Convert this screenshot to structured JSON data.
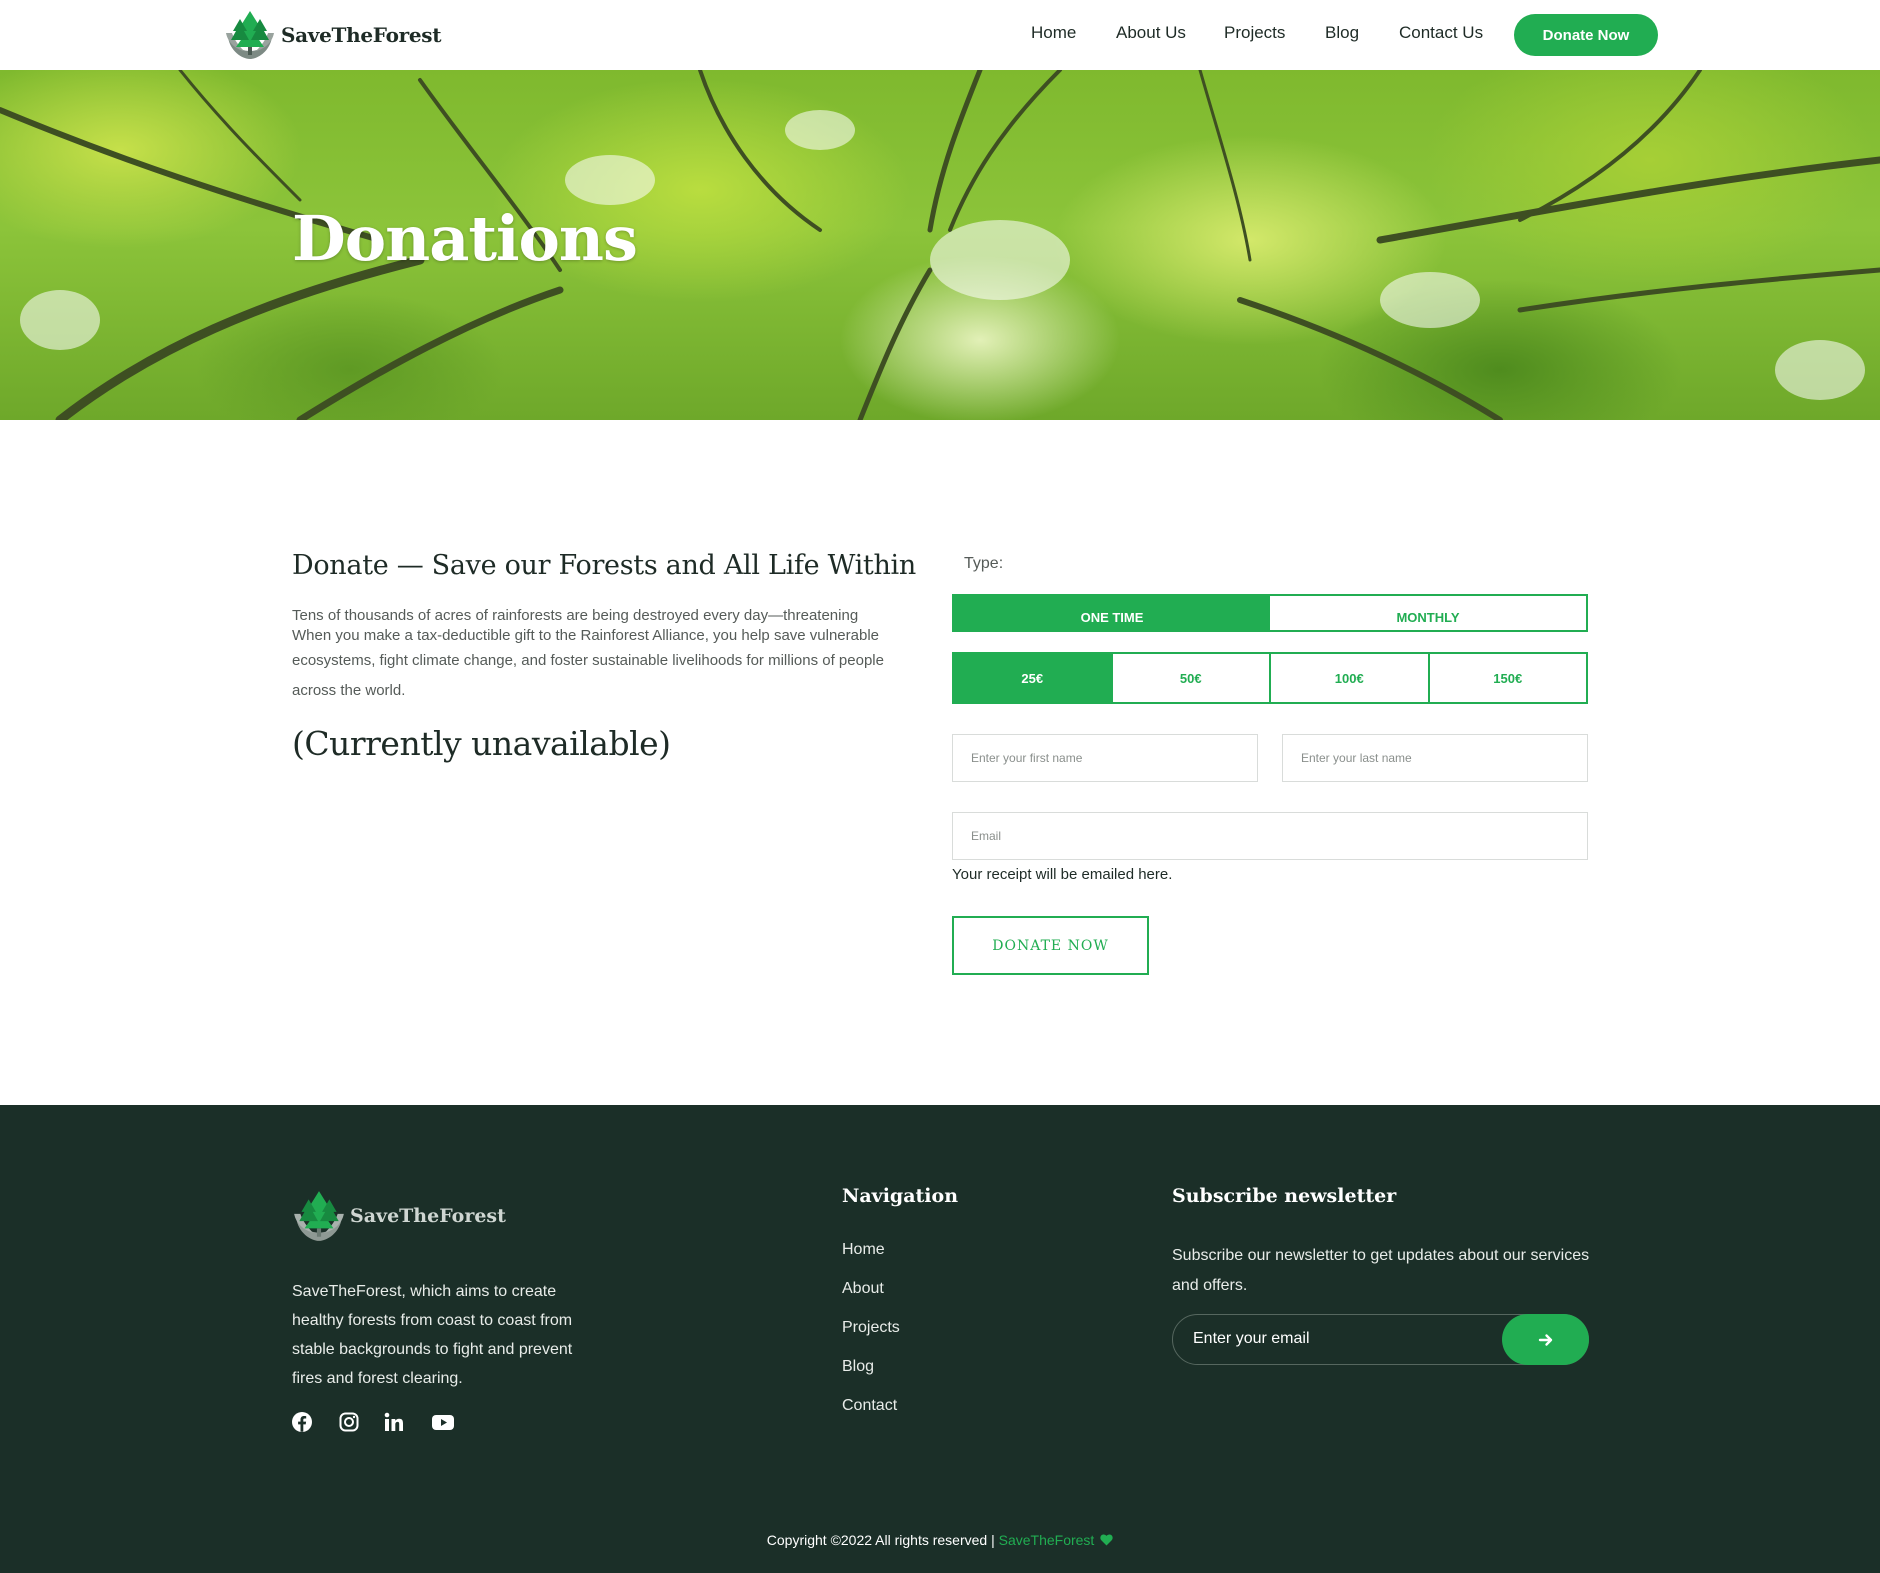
{
  "brand": {
    "name": "SaveTheForest",
    "accent_color": "#21ad52",
    "footer_bg": "#1b2f28"
  },
  "header": {
    "nav": [
      "Home",
      "About Us",
      "Projects",
      "Blog",
      "Contact Us"
    ],
    "cta_label": "Donate Now"
  },
  "hero": {
    "title": "Donations"
  },
  "main": {
    "heading": "Donate — Save our Forests and All Life Within",
    "text_line1": "Tens of thousands of acres of rainforests are being destroyed every day—threatening",
    "text_line2": "When you make a tax-deductible gift to the Rainforest Alliance, you help save vulnerable",
    "text_line3": "ecosystems, fight climate change, and foster sustainable livelihoods for millions of people",
    "text_line4": "across the world.",
    "unavailable": "(Currently unavailable)"
  },
  "form": {
    "type_label": "Type:",
    "type_options": [
      "ONE TIME",
      "MONTHLY"
    ],
    "selected_type": "ONE TIME",
    "amounts": [
      "25€",
      "50€",
      "100€",
      "150€"
    ],
    "selected_amount": "25€",
    "first_name_placeholder": "Enter your first name",
    "last_name_placeholder": "Enter your last name",
    "email_placeholder": "Email",
    "receipt_note": "Your receipt will be emailed here.",
    "submit_label": "DONATE NOW"
  },
  "footer": {
    "description": "SaveTheForest, which aims to create healthy forests from coast to coast from stable backgrounds to fight and prevent fires and forest clearing.",
    "social_icons": [
      "facebook-icon",
      "instagram-icon",
      "linkedin-icon",
      "youtube-icon"
    ],
    "nav_heading": "Navigation",
    "nav_items": [
      "Home",
      "About",
      "Projects",
      "Blog",
      "Contact"
    ],
    "newsletter_heading": "Subscribe newsletter",
    "newsletter_text": "Subscribe our newsletter to get updates about our services and offers.",
    "newsletter_input_placeholder": "Enter your email",
    "copyright": "Copyright ©2022 All rights reserved | ",
    "copyright_brand": "SaveTheForest"
  }
}
